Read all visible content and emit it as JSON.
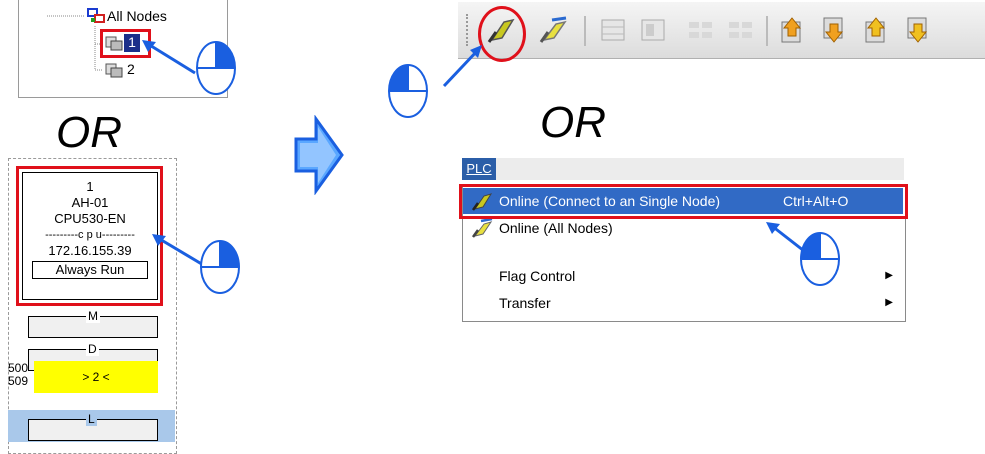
{
  "tree": {
    "root_label": "All Nodes",
    "node1_label": "1",
    "node2_label": "2"
  },
  "or_left": "OR",
  "or_right": "OR",
  "station": {
    "number": "1",
    "model": "AH-01",
    "cpu": "CPU530-EN",
    "cpu_divider": "---------c p u---------",
    "ip": "172.16.155.39",
    "mode_label": "Always Run",
    "slot_m": "M",
    "slot_d": "D",
    "slot_l": "L",
    "addr_top": "500",
    "addr_bottom": "509",
    "slot_value": "> 2 <"
  },
  "menu": {
    "title": "PLC",
    "items": [
      {
        "label": "Online (Connect to an Single Node)",
        "shortcut": "Ctrl+Alt+O"
      },
      {
        "label": "Online (All Nodes)",
        "shortcut": ""
      },
      {
        "label": "Flag Control",
        "submenu": "▶"
      },
      {
        "label": "Transfer",
        "submenu": "▶"
      }
    ]
  },
  "colors": {
    "highlight_red": "#e0101a",
    "arrow_blue": "#1a5fe0",
    "menu_selected": "#316ac5",
    "menu_title": "#2b5ea8",
    "slot_yellow": "#ffff00",
    "slot_blue": "#a9c8ea"
  },
  "icons": {
    "mouse": "mouse-right-click-icon",
    "big_arrow": "right-arrow-icon"
  }
}
